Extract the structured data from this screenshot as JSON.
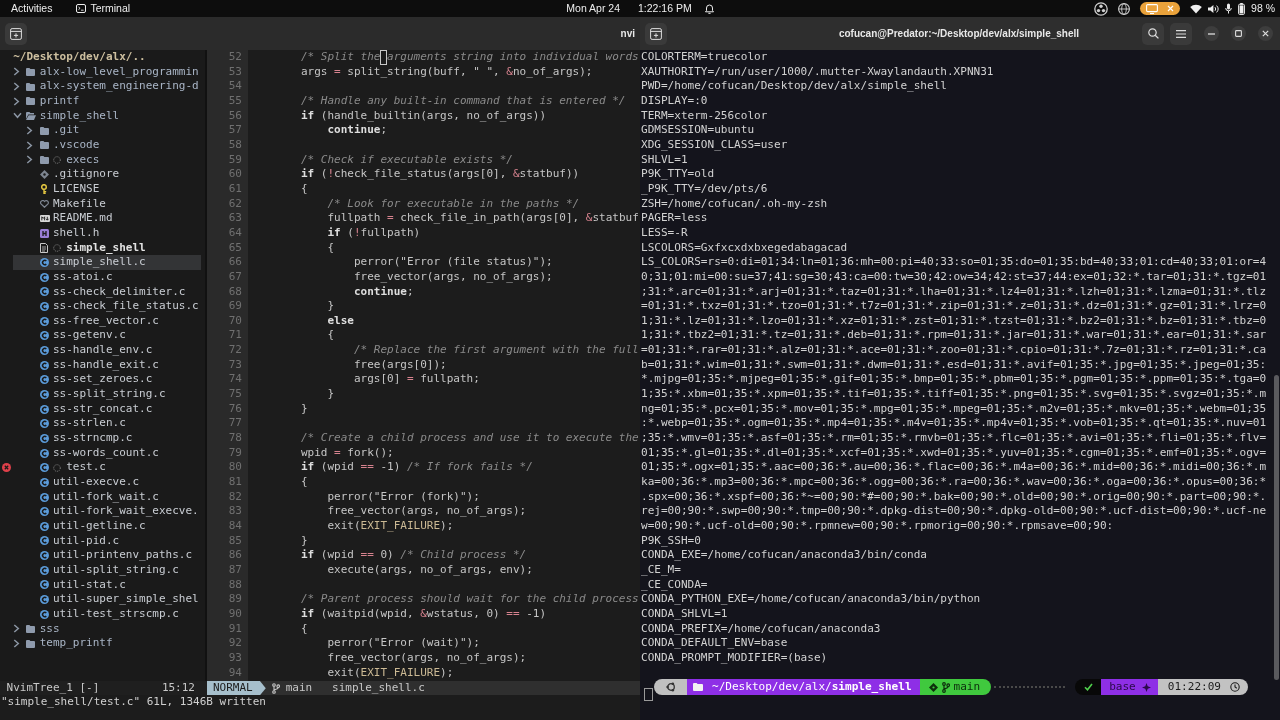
{
  "top_bar": {
    "activities": "Activities",
    "app_menu": "Terminal",
    "date": "Mon Apr 24",
    "time": "1:22:16 PM",
    "battery": "98 %"
  },
  "editor_window": {
    "title": "nvi",
    "file_tree": {
      "root": "~/Desktop/dev/alx/..",
      "items": [
        {
          "name": "alx-low_level_programmin",
          "kind": "folder",
          "expanded": false,
          "selected": false,
          "ignored": false,
          "error": false
        },
        {
          "name": "alx-system_engineering-d",
          "kind": "folder",
          "expanded": false,
          "selected": false,
          "ignored": false,
          "error": false
        },
        {
          "name": "printf",
          "kind": "folder",
          "expanded": false,
          "selected": false,
          "ignored": false,
          "error": false
        },
        {
          "name": "simple_shell",
          "kind": "folder",
          "expanded": true,
          "selected": false,
          "ignored": false,
          "error": false,
          "children": [
            {
              "name": ".git",
              "kind": "folder",
              "expanded": false,
              "selected": false,
              "ignored": false,
              "error": false
            },
            {
              "name": ".vscode",
              "kind": "folder",
              "expanded": false,
              "selected": false,
              "ignored": false,
              "error": false
            },
            {
              "name": "execs",
              "kind": "folder",
              "expanded": false,
              "selected": false,
              "ignored": true,
              "error": false
            },
            {
              "name": ".gitignore",
              "kind": "gitignore",
              "selected": false,
              "ignored": false,
              "error": false
            },
            {
              "name": "LICENSE",
              "kind": "license",
              "selected": false,
              "ignored": false,
              "error": false
            },
            {
              "name": "Makefile",
              "kind": "makefile",
              "selected": false,
              "ignored": false,
              "error": false
            },
            {
              "name": "README.md",
              "kind": "markdown",
              "selected": false,
              "ignored": false,
              "error": false
            },
            {
              "name": "shell.h",
              "kind": "header",
              "selected": false,
              "ignored": false,
              "error": false
            },
            {
              "name": "simple_shell",
              "kind": "binary",
              "selected": false,
              "ignored": true,
              "error": false
            },
            {
              "name": "simple_shell.c",
              "kind": "c",
              "selected": true,
              "ignored": false,
              "error": false
            },
            {
              "name": "ss-atoi.c",
              "kind": "c",
              "selected": false,
              "ignored": false,
              "error": false
            },
            {
              "name": "ss-check_delimiter.c",
              "kind": "c",
              "selected": false,
              "ignored": false,
              "error": false
            },
            {
              "name": "ss-check_file_status.c",
              "kind": "c",
              "selected": false,
              "ignored": false,
              "error": false
            },
            {
              "name": "ss-free_vector.c",
              "kind": "c",
              "selected": false,
              "ignored": false,
              "error": false
            },
            {
              "name": "ss-getenv.c",
              "kind": "c",
              "selected": false,
              "ignored": false,
              "error": false
            },
            {
              "name": "ss-handle_env.c",
              "kind": "c",
              "selected": false,
              "ignored": false,
              "error": false
            },
            {
              "name": "ss-handle_exit.c",
              "kind": "c",
              "selected": false,
              "ignored": false,
              "error": false
            },
            {
              "name": "ss-set_zeroes.c",
              "kind": "c",
              "selected": false,
              "ignored": false,
              "error": false
            },
            {
              "name": "ss-split_string.c",
              "kind": "c",
              "selected": false,
              "ignored": false,
              "error": false
            },
            {
              "name": "ss-str_concat.c",
              "kind": "c",
              "selected": false,
              "ignored": false,
              "error": false
            },
            {
              "name": "ss-strlen.c",
              "kind": "c",
              "selected": false,
              "ignored": false,
              "error": false
            },
            {
              "name": "ss-strncmp.c",
              "kind": "c",
              "selected": false,
              "ignored": false,
              "error": false
            },
            {
              "name": "ss-words_count.c",
              "kind": "c",
              "selected": false,
              "ignored": false,
              "error": false
            },
            {
              "name": "test.c",
              "kind": "c",
              "selected": false,
              "ignored": true,
              "error": true
            },
            {
              "name": "util-execve.c",
              "kind": "c",
              "selected": false,
              "ignored": false,
              "error": false
            },
            {
              "name": "util-fork_wait.c",
              "kind": "c",
              "selected": false,
              "ignored": false,
              "error": false
            },
            {
              "name": "util-fork_wait_execve.",
              "kind": "c",
              "selected": false,
              "ignored": false,
              "error": false
            },
            {
              "name": "util-getline.c",
              "kind": "c",
              "selected": false,
              "ignored": false,
              "error": false
            },
            {
              "name": "util-pid.c",
              "kind": "c",
              "selected": false,
              "ignored": false,
              "error": false
            },
            {
              "name": "util-printenv_paths.c",
              "kind": "c",
              "selected": false,
              "ignored": false,
              "error": false
            },
            {
              "name": "util-split_string.c",
              "kind": "c",
              "selected": false,
              "ignored": false,
              "error": false
            },
            {
              "name": "util-stat.c",
              "kind": "c",
              "selected": false,
              "ignored": false,
              "error": false
            },
            {
              "name": "util-super_simple_shel",
              "kind": "c",
              "selected": false,
              "ignored": false,
              "error": false
            },
            {
              "name": "util-test_strscmp.c",
              "kind": "c",
              "selected": false,
              "ignored": false,
              "error": false
            }
          ]
        },
        {
          "name": "sss",
          "kind": "folder",
          "expanded": false,
          "selected": false,
          "ignored": false,
          "error": false
        },
        {
          "name": "temp_printf",
          "kind": "folder",
          "expanded": false,
          "selected": false,
          "ignored": false,
          "error": false
        }
      ]
    },
    "code_lines": [
      {
        "number": "52",
        "code": [
          {
            "kind": "comment",
            "text": "        /* Split the"
          },
          {
            "kind": "comment",
            "text": " arguments string into individual words",
            "cursor": true
          }
        ]
      },
      {
        "number": "53",
        "code": [
          {
            "kind": "text",
            "text": "        args "
          },
          {
            "kind": "op",
            "text": "="
          },
          {
            "kind": "text",
            "text": " split_string(buff, \" \", "
          },
          {
            "kind": "op",
            "text": "&"
          },
          {
            "kind": "text",
            "text": "no_of_args);"
          }
        ]
      },
      {
        "number": "54"
      },
      {
        "number": "55",
        "code": [
          {
            "kind": "comment",
            "text": "        /* Handle any built-in command that is entered */"
          }
        ]
      },
      {
        "number": "56",
        "code": [
          {
            "kind": "keyword",
            "text": "        if"
          },
          {
            "kind": "text",
            "text": " (handle_builtin(args, no_of_args))"
          }
        ]
      },
      {
        "number": "57",
        "code": [
          {
            "kind": "keyword",
            "text": "            continue"
          },
          {
            "kind": "text",
            "text": ";"
          }
        ]
      },
      {
        "number": "58"
      },
      {
        "number": "59",
        "code": [
          {
            "kind": "comment",
            "text": "        /* Check if executable exists */"
          }
        ]
      },
      {
        "number": "60",
        "code": [
          {
            "kind": "keyword",
            "text": "        if"
          },
          {
            "kind": "text",
            "text": " ("
          },
          {
            "kind": "op",
            "text": "!"
          },
          {
            "kind": "text",
            "text": "check_file_status(args[0], "
          },
          {
            "kind": "op",
            "text": "&"
          },
          {
            "kind": "text",
            "text": "statbuf))"
          }
        ]
      },
      {
        "number": "61",
        "code": [
          {
            "kind": "text",
            "text": "        {"
          }
        ]
      },
      {
        "number": "62",
        "code": [
          {
            "kind": "comment",
            "text": "            /* Look for executable in the paths */"
          }
        ]
      },
      {
        "number": "63",
        "code": [
          {
            "kind": "text",
            "text": "            fullpath "
          },
          {
            "kind": "op",
            "text": "="
          },
          {
            "kind": "text",
            "text": " check_file_in_path(args[0], "
          },
          {
            "kind": "op",
            "text": "&"
          },
          {
            "kind": "text",
            "text": "statbuf"
          }
        ]
      },
      {
        "number": "64",
        "code": [
          {
            "kind": "keyword",
            "text": "            if"
          },
          {
            "kind": "text",
            "text": " ("
          },
          {
            "kind": "op",
            "text": "!"
          },
          {
            "kind": "text",
            "text": "fullpath)"
          }
        ]
      },
      {
        "number": "65",
        "code": [
          {
            "kind": "text",
            "text": "            {"
          }
        ]
      },
      {
        "number": "66",
        "code": [
          {
            "kind": "text",
            "text": "                perror(\"Error (file status)\");"
          }
        ]
      },
      {
        "number": "67",
        "code": [
          {
            "kind": "text",
            "text": "                free_vector(args, no_of_args);"
          }
        ]
      },
      {
        "number": "68",
        "code": [
          {
            "kind": "keyword",
            "text": "                continue"
          },
          {
            "kind": "text",
            "text": ";"
          }
        ]
      },
      {
        "number": "69",
        "code": [
          {
            "kind": "text",
            "text": "            }"
          }
        ]
      },
      {
        "number": "70",
        "code": [
          {
            "kind": "keyword",
            "text": "            else"
          }
        ]
      },
      {
        "number": "71",
        "code": [
          {
            "kind": "text",
            "text": "            {"
          }
        ]
      },
      {
        "number": "72",
        "code": [
          {
            "kind": "comment",
            "text": "                /* Replace the first argument with the full"
          }
        ]
      },
      {
        "number": "73",
        "code": [
          {
            "kind": "text",
            "text": "                free(args[0]);"
          }
        ]
      },
      {
        "number": "74",
        "code": [
          {
            "kind": "text",
            "text": "                args[0] "
          },
          {
            "kind": "op",
            "text": "="
          },
          {
            "kind": "text",
            "text": " fullpath;"
          }
        ]
      },
      {
        "number": "75",
        "code": [
          {
            "kind": "text",
            "text": "            }"
          }
        ]
      },
      {
        "number": "76",
        "code": [
          {
            "kind": "text",
            "text": "        }"
          }
        ]
      },
      {
        "number": "77"
      },
      {
        "number": "78",
        "code": [
          {
            "kind": "comment",
            "text": "        /* Create a child process and use it to execute the"
          }
        ]
      },
      {
        "number": "79",
        "code": [
          {
            "kind": "text",
            "text": "        wpid "
          },
          {
            "kind": "op",
            "text": "="
          },
          {
            "kind": "text",
            "text": " fork();"
          }
        ]
      },
      {
        "number": "80",
        "code": [
          {
            "kind": "keyword",
            "text": "        if"
          },
          {
            "kind": "text",
            "text": " (wpid "
          },
          {
            "kind": "op",
            "text": "=="
          },
          {
            "kind": "text",
            "text": " -1) "
          },
          {
            "kind": "comment",
            "text": "/* If fork fails */"
          }
        ]
      },
      {
        "number": "81",
        "code": [
          {
            "kind": "text",
            "text": "        {"
          }
        ]
      },
      {
        "number": "82",
        "code": [
          {
            "kind": "text",
            "text": "            perror(\"Error (fork)\");"
          }
        ]
      },
      {
        "number": "83",
        "code": [
          {
            "kind": "text",
            "text": "            free_vector(args, no_of_args);"
          }
        ]
      },
      {
        "number": "84",
        "code": [
          {
            "kind": "text",
            "text": "            exit("
          },
          {
            "kind": "const",
            "text": "EXIT_FAILURE"
          },
          {
            "kind": "text",
            "text": ");"
          }
        ]
      },
      {
        "number": "85",
        "code": [
          {
            "kind": "text",
            "text": "        }"
          }
        ]
      },
      {
        "number": "86",
        "code": [
          {
            "kind": "keyword",
            "text": "        if"
          },
          {
            "kind": "text",
            "text": " (wpid "
          },
          {
            "kind": "op",
            "text": "=="
          },
          {
            "kind": "text",
            "text": " 0) "
          },
          {
            "kind": "comment",
            "text": "/* Child process */"
          }
        ]
      },
      {
        "number": "87",
        "code": [
          {
            "kind": "text",
            "text": "            execute(args, no_of_args, env);"
          }
        ]
      },
      {
        "number": "88"
      },
      {
        "number": "89",
        "code": [
          {
            "kind": "comment",
            "text": "        /* Parent process should wait for the child process"
          }
        ]
      },
      {
        "number": "90",
        "code": [
          {
            "kind": "keyword",
            "text": "        if"
          },
          {
            "kind": "text",
            "text": " (waitpid(wpid, "
          },
          {
            "kind": "op",
            "text": "&"
          },
          {
            "kind": "text",
            "text": "wstatus, 0) "
          },
          {
            "kind": "op",
            "text": "=="
          },
          {
            "kind": "text",
            "text": " -1)"
          }
        ]
      },
      {
        "number": "91",
        "code": [
          {
            "kind": "text",
            "text": "        {"
          }
        ]
      },
      {
        "number": "92",
        "code": [
          {
            "kind": "text",
            "text": "            perror(\"Error (wait)\");"
          }
        ]
      },
      {
        "number": "93",
        "code": [
          {
            "kind": "text",
            "text": "            free_vector(args, no_of_args);"
          }
        ]
      },
      {
        "number": "94",
        "code": [
          {
            "kind": "text",
            "text": "            exit("
          },
          {
            "kind": "const",
            "text": "EXIT_FAILURE"
          },
          {
            "kind": "text",
            "text": ");"
          }
        ]
      }
    ],
    "status_line": {
      "tree_label": "NvimTree_1 [-]",
      "tree_position": "15:12",
      "mode": "NORMAL",
      "branch": "main",
      "file": "simple_shell.c"
    },
    "message": "\"simple_shell/test.c\" 61L, 1346B written"
  },
  "terminal_window": {
    "title": "cofucan@Predator:~/Desktop/dev/alx/simple_shell",
    "lines": [
      "COLORTERM=truecolor",
      "XAUTHORITY=/run/user/1000/.mutter-Xwaylandauth.XPNN31",
      "PWD=/home/cofucan/Desktop/dev/alx/simple_shell",
      "DISPLAY=:0",
      "TERM=xterm-256color",
      "GDMSESSION=ubuntu",
      "XDG_SESSION_CLASS=user",
      "SHLVL=1",
      "P9K_TTY=old",
      "_P9K_TTY=/dev/pts/6",
      "ZSH=/home/cofucan/.oh-my-zsh",
      "PAGER=less",
      "LESS=-R",
      "LSCOLORS=Gxfxcxdxbxegedabagacad",
      "LS_COLORS=rs=0:di=01;34:ln=01;36:mh=00:pi=40;33:so=01;35:do=01;35:bd=40;33;01:cd=40;33;01:or=4",
      "0;31;01:mi=00:su=37;41:sg=30;43:ca=00:tw=30;42:ow=34;42:st=37;44:ex=01;32:*.tar=01;31:*.tgz=01",
      ";31:*.arc=01;31:*.arj=01;31:*.taz=01;31:*.lha=01;31:*.lz4=01;31:*.lzh=01;31:*.lzma=01;31:*.tlz",
      "=01;31:*.txz=01;31:*.tzo=01;31:*.t7z=01;31:*.zip=01;31:*.z=01;31:*.dz=01;31:*.gz=01;31:*.lrz=0",
      "1;31:*.lz=01;31:*.lzo=01;31:*.xz=01;31:*.zst=01;31:*.tzst=01;31:*.bz2=01;31:*.bz=01;31:*.tbz=0",
      "1;31:*.tbz2=01;31:*.tz=01;31:*.deb=01;31:*.rpm=01;31:*.jar=01;31:*.war=01;31:*.ear=01;31:*.sar",
      "=01;31:*.rar=01;31:*.alz=01;31:*.ace=01;31:*.zoo=01;31:*.cpio=01;31:*.7z=01;31:*.rz=01;31:*.ca",
      "b=01;31:*.wim=01;31:*.swm=01;31:*.dwm=01;31:*.esd=01;31:*.avif=01;35:*.jpg=01;35:*.jpeg=01;35:",
      "*.mjpg=01;35:*.mjpeg=01;35:*.gif=01;35:*.bmp=01;35:*.pbm=01;35:*.pgm=01;35:*.ppm=01;35:*.tga=0",
      "1;35:*.xbm=01;35:*.xpm=01;35:*.tif=01;35:*.tiff=01;35:*.png=01;35:*.svg=01;35:*.svgz=01;35:*.m",
      "ng=01;35:*.pcx=01;35:*.mov=01;35:*.mpg=01;35:*.mpeg=01;35:*.m2v=01;35:*.mkv=01;35:*.webm=01;35",
      ":*.webp=01;35:*.ogm=01;35:*.mp4=01;35:*.m4v=01;35:*.mp4v=01;35:*.vob=01;35:*.qt=01;35:*.nuv=01",
      ";35:*.wmv=01;35:*.asf=01;35:*.rm=01;35:*.rmvb=01;35:*.flc=01;35:*.avi=01;35:*.fli=01;35:*.flv=",
      "01;35:*.gl=01;35:*.dl=01;35:*.xcf=01;35:*.xwd=01;35:*.yuv=01;35:*.cgm=01;35:*.emf=01;35:*.ogv=",
      "01;35:*.ogx=01;35:*.aac=00;36:*.au=00;36:*.flac=00;36:*.m4a=00;36:*.mid=00;36:*.midi=00;36:*.m",
      "ka=00;36:*.mp3=00;36:*.mpc=00;36:*.ogg=00;36:*.ra=00;36:*.wav=00;36:*.oga=00;36:*.opus=00;36:*",
      ".spx=00;36:*.xspf=00;36:*~=00;90:*#=00;90:*.bak=00;90:*.old=00;90:*.orig=00;90:*.part=00;90:*.",
      "rej=00;90:*.swp=00;90:*.tmp=00;90:*.dpkg-dist=00;90:*.dpkg-old=00;90:*.ucf-dist=00;90:*.ucf-ne",
      "w=00;90:*.ucf-old=00;90:*.rpmnew=00;90:*.rpmorig=00;90:*.rpmsave=00;90:",
      "P9K_SSH=0",
      "CONDA_EXE=/home/cofucan/anaconda3/bin/conda",
      "_CE_M=",
      "_CE_CONDA=",
      "CONDA_PYTHON_EXE=/home/cofucan/anaconda3/bin/python",
      "CONDA_SHLVL=1",
      "CONDA_PREFIX=/home/cofucan/anaconda3",
      "CONDA_DEFAULT_ENV=base",
      "CONDA_PROMPT_MODIFIER=(base)"
    ],
    "prompt": {
      "path": "~/Desktop/dev/alx/**simple_shell**",
      "branch": "main",
      "environment": "base",
      "time": "01:22:09"
    }
  }
}
